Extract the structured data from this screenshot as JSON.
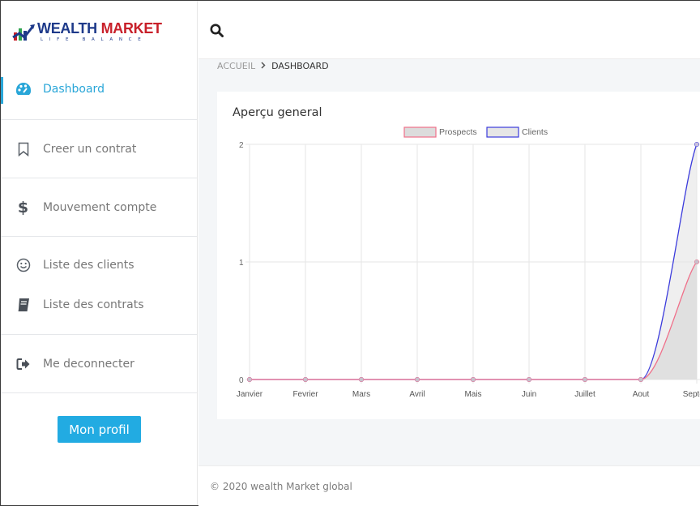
{
  "logo": {
    "word1": "WEALTH",
    "word2": "MARKET",
    "tagline": "LIFE BALANCE"
  },
  "sidebar": {
    "items": [
      {
        "label": "Dashboard",
        "icon": "palette-icon",
        "active": true
      },
      {
        "label": "Creer un contrat",
        "icon": "bookmark-icon"
      },
      {
        "label": "Mouvement compte",
        "icon": "dollar-icon"
      },
      {
        "label": "Liste des clients",
        "icon": "smile-icon"
      },
      {
        "label": "Liste des contrats",
        "icon": "book-icon"
      },
      {
        "label": "Me deconnecter",
        "icon": "sign-out-icon"
      }
    ],
    "profile_button": "Mon profil"
  },
  "topbar": {
    "search_icon": "search-icon"
  },
  "breadcrumb": {
    "home": "ACCUEIL",
    "current": "DASHBOARD"
  },
  "card": {
    "title": "Aperçu general"
  },
  "chart_data": {
    "type": "line",
    "categories": [
      "Janvier",
      "Fevrier",
      "Mars",
      "Avril",
      "Mais",
      "Juin",
      "Juillet",
      "Aout",
      "Septem"
    ],
    "series": [
      {
        "name": "Prospects",
        "values": [
          0,
          0,
          0,
          0,
          0,
          0,
          0,
          0,
          1
        ],
        "stroke": "#f0708a",
        "fill": "#dcdcdc"
      },
      {
        "name": "Clients",
        "values": [
          0,
          0,
          0,
          0,
          0,
          0,
          0,
          0,
          2
        ],
        "stroke": "#3b3bdc",
        "fill": "#e6e6e6"
      }
    ],
    "ylim": [
      0,
      2
    ],
    "yticks": [
      "0",
      "1",
      "2"
    ],
    "grid": true,
    "legend": "top"
  },
  "footer": {
    "text": "© 2020 wealth Market global"
  }
}
